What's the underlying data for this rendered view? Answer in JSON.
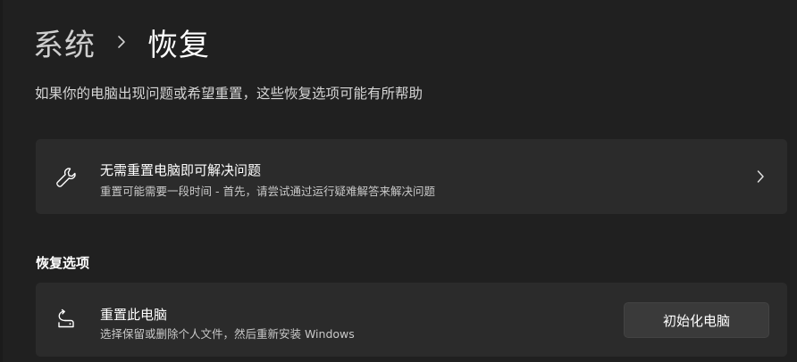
{
  "breadcrumb": {
    "parent": "系统",
    "current": "恢复"
  },
  "page": {
    "description": "如果你的电脑出现问题或希望重置，这些恢复选项可能有所帮助"
  },
  "troubleshoot_card": {
    "title": "无需重置电脑即可解决问题",
    "subtitle": "重置可能需要一段时间 - 首先，请尝试通过运行疑难解答来解决问题",
    "icon": "wrench-icon"
  },
  "recovery_options": {
    "section_title": "恢复选项",
    "reset_card": {
      "title": "重置此电脑",
      "subtitle": "选择保留或删除个人文件，然后重新安装 Windows",
      "button_label": "初始化电脑",
      "icon": "reset-pc-icon"
    }
  },
  "colors": {
    "background": "#202020",
    "card": "#2b2b2b",
    "button": "#3a3a3a",
    "text_primary": "#ffffff",
    "text_secondary": "#c9c9c9"
  }
}
